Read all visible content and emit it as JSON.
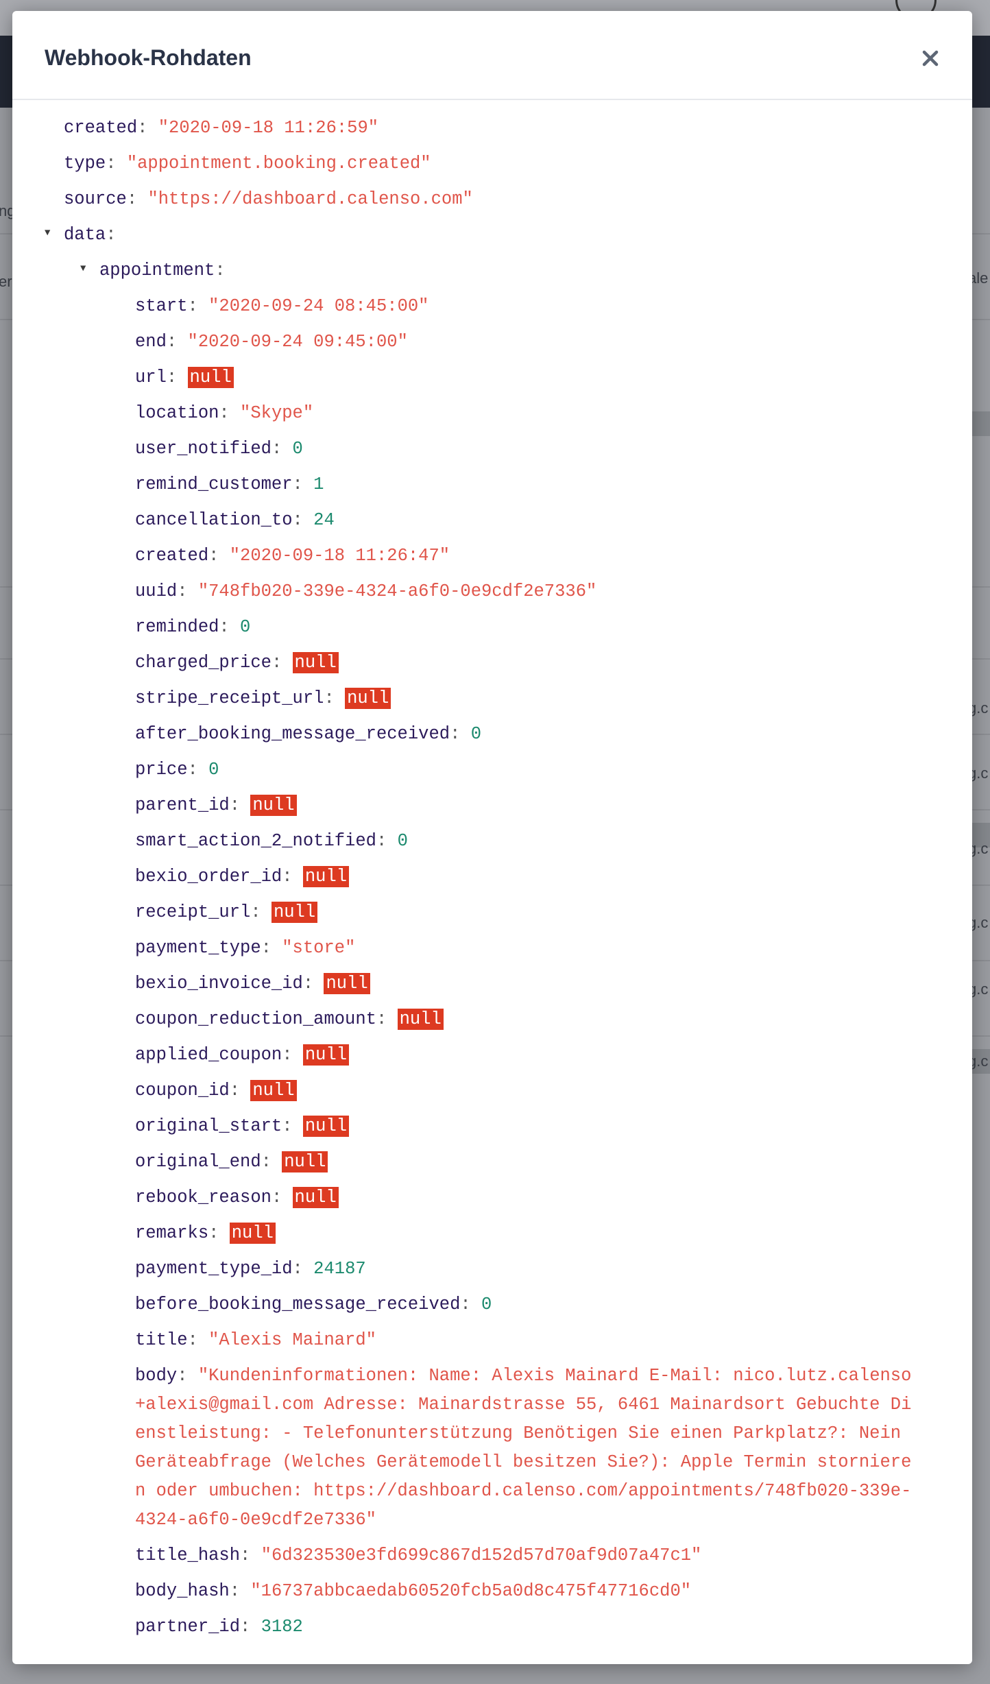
{
  "modal": {
    "title": "Webhook-Rohdaten",
    "close_icon": "close-icon"
  },
  "payload": {
    "created": "\"2020-09-18 11:26:59\"",
    "type": "\"appointment.booking.created\"",
    "source": "\"https://dashboard.calenso.com\"",
    "data_key": "data",
    "appointment_key": "appointment",
    "appointment": {
      "start": "\"2020-09-24 08:45:00\"",
      "end": "\"2020-09-24 09:45:00\"",
      "url": "null",
      "location": "\"Skype\"",
      "user_notified": "0",
      "remind_customer": "1",
      "cancellation_to": "24",
      "created": "\"2020-09-18 11:26:47\"",
      "uuid": "\"748fb020-339e-4324-a6f0-0e9cdf2e7336\"",
      "reminded": "0",
      "charged_price": "null",
      "stripe_receipt_url": "null",
      "after_booking_message_received": "0",
      "price": "0",
      "parent_id": "null",
      "smart_action_2_notified": "0",
      "bexio_order_id": "null",
      "receipt_url": "null",
      "payment_type": "\"store\"",
      "bexio_invoice_id": "null",
      "coupon_reduction_amount": "null",
      "applied_coupon": "null",
      "coupon_id": "null",
      "original_start": "null",
      "original_end": "null",
      "rebook_reason": "null",
      "remarks": "null",
      "payment_type_id": "24187",
      "before_booking_message_received": "0",
      "title": "\"Alexis Mainard\"",
      "body": "\"Kundeninformationen: Name: Alexis Mainard E-Mail: nico.lutz.calenso+alexis@gmail.com Adresse: Mainardstrasse 55, 6461 Mainardsort Gebuchte Dienstleistung: - Telefonunterstützung Benötigen Sie einen Parkplatz?: Nein Geräteabfrage (Welches Gerätemodell besitzen Sie?): Apple Termin stornieren oder umbuchen: https://dashboard.calenso.com/appointments/748fb020-339e-4324-a6f0-0e9cdf2e7336\"",
      "title_hash": "\"6d323530e3fd699c867d152d57d70af9d07a47c1\"",
      "body_hash": "\"16737abbcaedab60520fcb5a0d8c475f47716cd0\"",
      "partner_id": "3182"
    }
  },
  "background": {
    "left_edge": [
      "ng",
      "er"
    ],
    "right_edge": [
      "ale",
      "g.c",
      "g.c",
      "g.c",
      "g.c",
      "g.c",
      "g.c"
    ]
  }
}
